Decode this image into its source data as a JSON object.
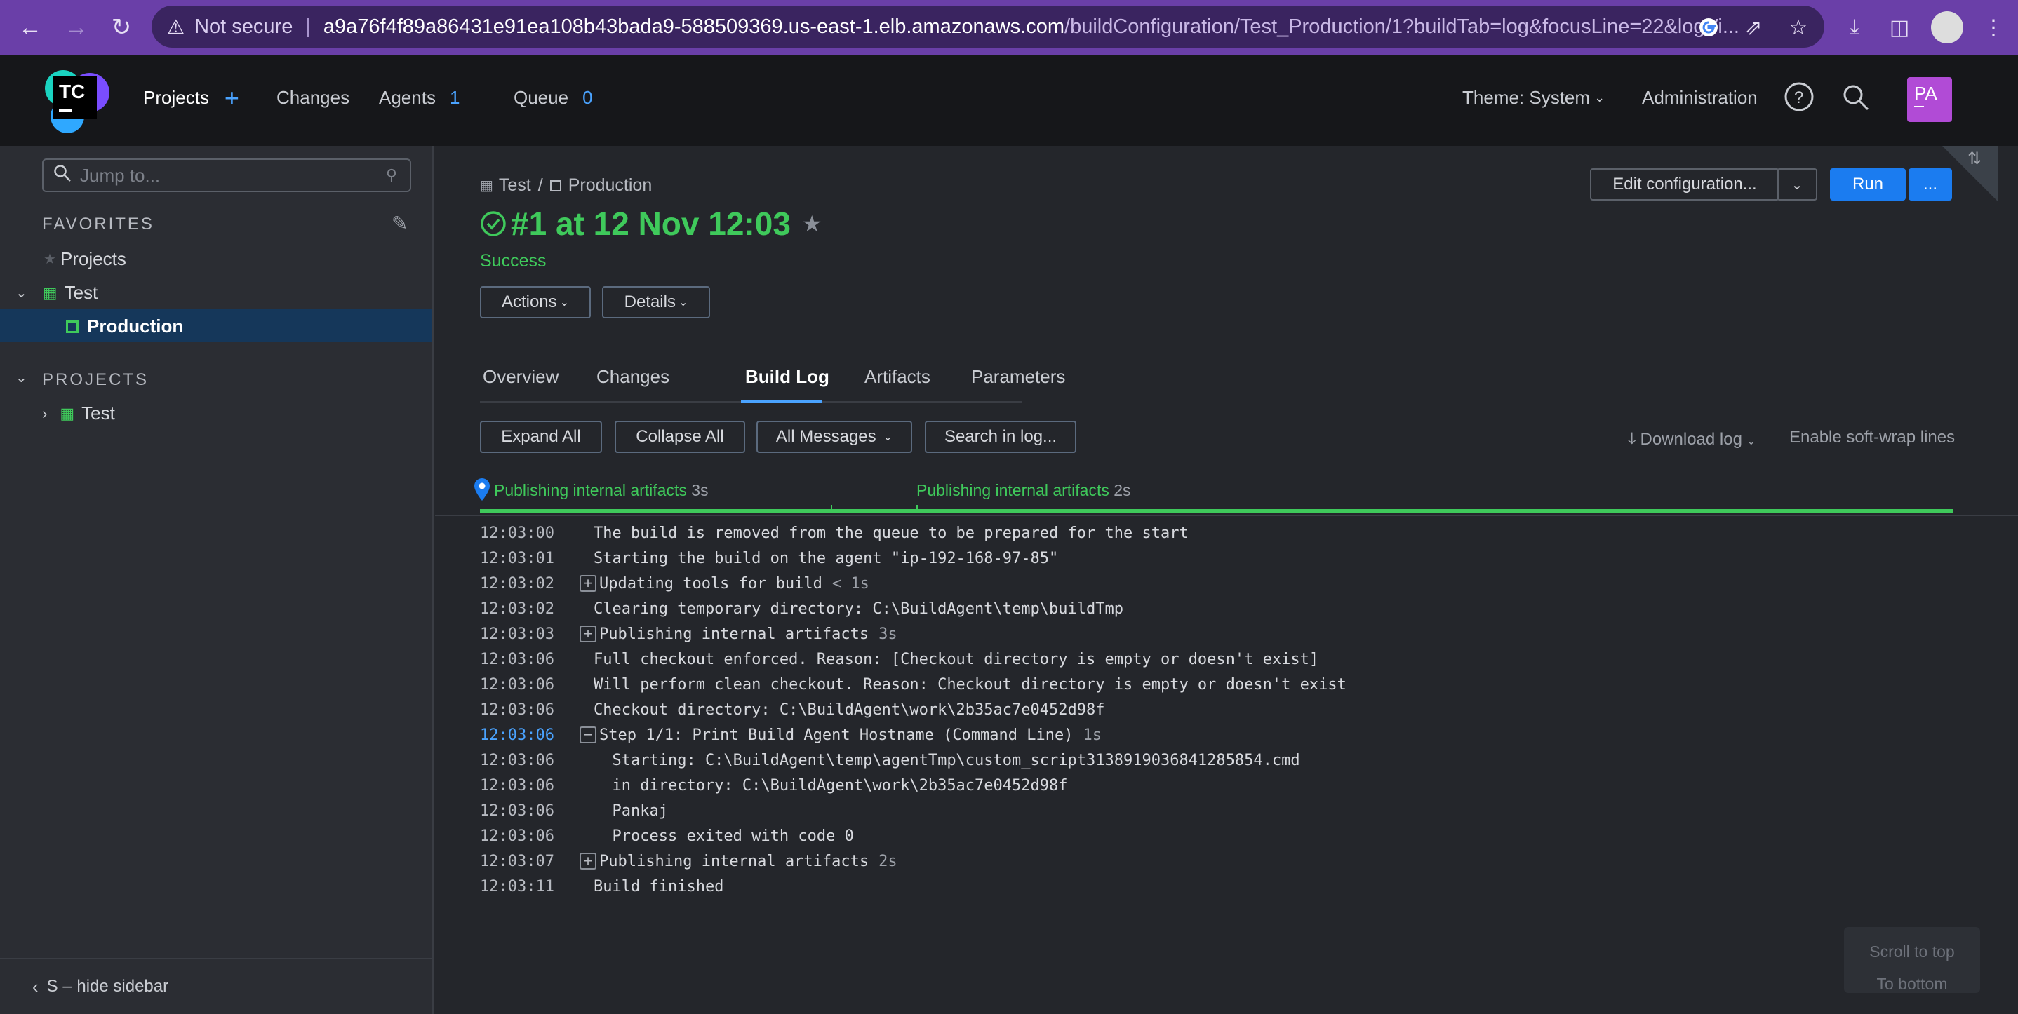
{
  "browser": {
    "not_secure": "Not secure",
    "url_host": "a9a76f4f89a86431e91ea108b43bada9-588509369.us-east-1.elb.amazonaws.com",
    "url_path": "/buildConfiguration/Test_Production/1?buildTab=log&focusLine=22&logVi..."
  },
  "header": {
    "projects": "Projects",
    "changes": "Changes",
    "agents": "Agents",
    "agents_count": "1",
    "queue": "Queue",
    "queue_count": "0",
    "theme": "Theme: System",
    "administration": "Administration",
    "avatar": "PA",
    "logo": "TC"
  },
  "sidebar": {
    "jump_placeholder": "Jump to...",
    "favorites_title": "FAVORITES",
    "favorites": [
      {
        "label": "Projects"
      },
      {
        "label": "Test"
      },
      {
        "label": "Production"
      }
    ],
    "projects_title": "PROJECTS",
    "projects": [
      {
        "label": "Test"
      }
    ],
    "hide": "S – hide sidebar"
  },
  "build": {
    "crumb_project": "Test",
    "crumb_sep": "/",
    "crumb_config": "Production",
    "title": "#1 at 12 Nov 12:03",
    "status": "Success",
    "actions": "Actions",
    "details": "Details",
    "edit_config": "Edit configuration...",
    "run": "Run",
    "more": "..."
  },
  "tabs": [
    {
      "label": "Overview"
    },
    {
      "label": "Changes"
    },
    {
      "label": "Build Log",
      "active": true
    },
    {
      "label": "Artifacts"
    },
    {
      "label": "Parameters"
    }
  ],
  "log_toolbar": {
    "expand_all": "Expand All",
    "collapse_all": "Collapse All",
    "all_messages": "All Messages",
    "search": "Search in log...",
    "download": "Download log",
    "softwrap": "Enable soft-wrap lines"
  },
  "timeline": [
    {
      "label": "Publishing internal artifacts",
      "dur": "3s"
    },
    {
      "label": "Publishing internal artifacts",
      "dur": "2s"
    }
  ],
  "log": [
    {
      "ts": "12:03:00",
      "text": "The build is removed from the queue to be prepared for the start"
    },
    {
      "ts": "12:03:01",
      "text": "Starting the build on the agent \"ip-192-168-97-85\""
    },
    {
      "ts": "12:03:02",
      "text": "Updating tools for build",
      "dur": "< 1s",
      "expander": "+"
    },
    {
      "ts": "12:03:02",
      "text": "Clearing temporary directory: C:\\BuildAgent\\temp\\buildTmp"
    },
    {
      "ts": "12:03:03",
      "text": "Publishing internal artifacts",
      "dur": "3s",
      "expander": "+"
    },
    {
      "ts": "12:03:06",
      "text": "Full checkout enforced. Reason: [Checkout directory is empty or doesn't exist]"
    },
    {
      "ts": "12:03:06",
      "text": "Will perform clean checkout. Reason: Checkout directory is empty or doesn't exist"
    },
    {
      "ts": "12:03:06",
      "text": "Checkout directory: C:\\BuildAgent\\work\\2b35ac7e0452d98f"
    },
    {
      "ts": "12:03:06",
      "text": "Step 1/1: Print Build Agent Hostname (Command Line)",
      "dur": "1s",
      "expander": "−",
      "highlight": true
    },
    {
      "ts": "12:03:06",
      "text": "  Starting: C:\\BuildAgent\\temp\\agentTmp\\custom_script3138919036841285854.cmd"
    },
    {
      "ts": "12:03:06",
      "text": "  in directory: C:\\BuildAgent\\work\\2b35ac7e0452d98f"
    },
    {
      "ts": "12:03:06",
      "text": "  Pankaj"
    },
    {
      "ts": "12:03:06",
      "text": "  Process exited with code 0"
    },
    {
      "ts": "12:03:07",
      "text": "Publishing internal artifacts",
      "dur": "2s",
      "expander": "+"
    },
    {
      "ts": "12:03:11",
      "text": "Build finished"
    }
  ],
  "scroll": {
    "top": "Scroll to top",
    "bottom": "To bottom"
  },
  "colors": {
    "accent": "#1b7cf0",
    "success": "#3fc95b",
    "chrome": "#6a3fa8"
  }
}
